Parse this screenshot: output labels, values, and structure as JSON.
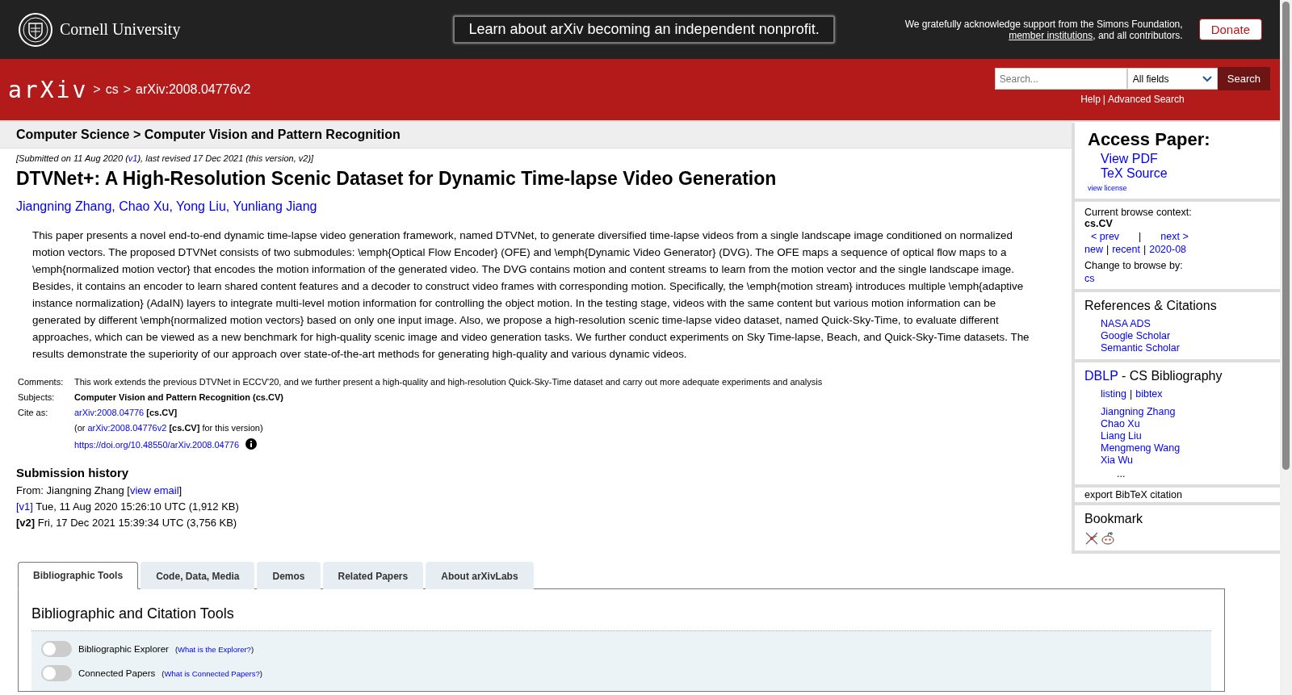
{
  "top_banner": {
    "institution": "Cornell University",
    "announcement": "Learn about arXiv becoming an independent nonprofit.",
    "acknowledgment": {
      "before": "We gratefully acknowledge support from the Simons Foundation, ",
      "link": "member institutions",
      "after": ", and all contributors."
    },
    "donate": "Donate"
  },
  "header": {
    "logo": "arXiv",
    "breadcrumbs": [
      {
        "separator": ">",
        "label": "cs"
      },
      {
        "separator": ">",
        "label": "arXiv:2008.04776v2"
      }
    ],
    "search": {
      "placeholder": "Search...",
      "field_select": "All fields",
      "button": "Search",
      "help": "Help",
      "divider": "|",
      "advanced": "Advanced Search"
    }
  },
  "subheader": "Computer Science > Computer Vision and Pattern Recognition",
  "dateline": {
    "before": "[Submitted on 11 Aug 2020 (",
    "link": "v1",
    "after": "), last revised 17 Dec 2021 (this version, v2)]"
  },
  "title": "DTVNet+: A High-Resolution Scenic Dataset for Dynamic Time-lapse Video Generation",
  "authors": [
    {
      "name": "Jiangning Zhang",
      "separator": ","
    },
    {
      "name": "Chao Xu",
      "separator": ","
    },
    {
      "name": "Yong Liu",
      "separator": ","
    },
    {
      "name": "Yunliang Jiang"
    }
  ],
  "abstract": "This paper presents a novel end-to-end dynamic time-lapse video generation framework, named DTVNet, to generate diversified time-lapse videos from a single landscape image conditioned on normalized motion vectors. The proposed DTVNet consists of two submodules: \\emph{Optical Flow Encoder} (OFE) and \\emph{Dynamic Video Generator} (DVG). The OFE maps a sequence of optical flow maps to a \\emph{normalized motion vector} that encodes the motion information of the generated video. The DVG contains motion and content streams to learn from the motion vector and the single landscape image. Besides, it contains an encoder to learn shared content features and a decoder to construct video frames with corresponding motion. Specifically, the \\emph{motion stream} introduces multiple \\emph{adaptive instance normalization} (AdaIN) layers to integrate multi-level motion information for controlling the object motion. In the testing stage, videos with the same content but various motion information can be generated by different \\emph{normalized motion vectors} based on only one input image. Also, we propose a high-resolution scenic time-lapse video dataset, named Quick-Sky-Time, to evaluate different approaches, which can be viewed as a new benchmark for high-quality scenic image and video generation tasks. We further conduct experiments on Sky Time-lapse, Beach, and Quick-Sky-Time datasets. The results demonstrate the superiority of our approach over state-of-the-art methods for generating high-quality and various dynamic videos.",
  "metadata": {
    "comments_label": "Comments:",
    "comments": "This work extends the previous DTVNet in ECCV'20, and we further present a high-quality and high-resolution Quick-Sky-Time dataset and carry out more adequate experiments and analysis",
    "subjects_label": "Subjects:",
    "subjects": "Computer Vision and Pattern Recognition (cs.CV)",
    "cite_label": "Cite as:",
    "cite_link": "arXiv:2008.04776",
    "cite_tag": "[cs.CV]",
    "version_cite": {
      "before": "(or ",
      "link": "arXiv:2008.04776v2",
      "tag": "**[cs.CV]** for this version)"
    },
    "doi": "https://doi.org/10.48550/arXiv.2008.04776"
  },
  "submission_history": {
    "heading": "Submission history",
    "from": {
      "before": "From: Jiangning Zhang [",
      "link": "view email",
      "after": "]"
    },
    "versions": [
      {
        "label": "[v1]",
        "linked": true,
        "details": "Tue, 11 Aug 2020 15:26:10 UTC (1,912 KB)"
      },
      {
        "label": "[v2]",
        "linked": false,
        "details": "Fri, 17 Dec 2021 15:39:34 UTC (3,756 KB)"
      }
    ]
  },
  "sidebar": {
    "access": {
      "heading": "Access Paper:",
      "links": [
        "View PDF",
        "TeX Source"
      ],
      "license": "view license"
    },
    "browse": {
      "label": "Current browse context:",
      "context": "cs.CV",
      "prev": "< prev",
      "divider": "|",
      "next": "next >",
      "links": [
        {
          "label": "new",
          "separator": "|"
        },
        {
          "label": "recent",
          "separator": "|"
        },
        {
          "label": "2020-08"
        }
      ],
      "change_label": "Change to browse by:",
      "change_links": [
        "cs"
      ]
    },
    "references": {
      "heading": "References & Citations",
      "links": [
        "NASA ADS",
        "Google Scholar",
        "Semantic Scholar"
      ]
    },
    "dblp": {
      "link": "DBLP",
      "heading": "- CS Bibliography",
      "listing": "listing",
      "divider": "|",
      "bibtex": "bibtex",
      "authors": [
        "Jiangning Zhang",
        "Chao Xu",
        "Liang Liu",
        "Mengmeng Wang",
        "Xia Wu"
      ],
      "more": "..."
    },
    "export": "export BibTeX citation",
    "bookmark": {
      "heading": "Bookmark"
    }
  },
  "tabs": [
    {
      "label": "Bibliographic Tools",
      "selected": true
    },
    {
      "label": "Code, Data, Media",
      "selected": false
    },
    {
      "label": "Demos",
      "selected": false
    },
    {
      "label": "Related Papers",
      "selected": false
    },
    {
      "label": "About arXivLabs",
      "selected": false
    }
  ],
  "tools": {
    "heading": "Bibliographic and Citation Tools",
    "toggles": [
      {
        "label": "Bibliographic Explorer",
        "on": false,
        "open": "(",
        "help": "What is the Explorer?",
        "close": ")"
      },
      {
        "label": "Connected Papers",
        "on": false,
        "open": "(",
        "help": "What is Connected Papers?",
        "close": ")"
      }
    ]
  }
}
